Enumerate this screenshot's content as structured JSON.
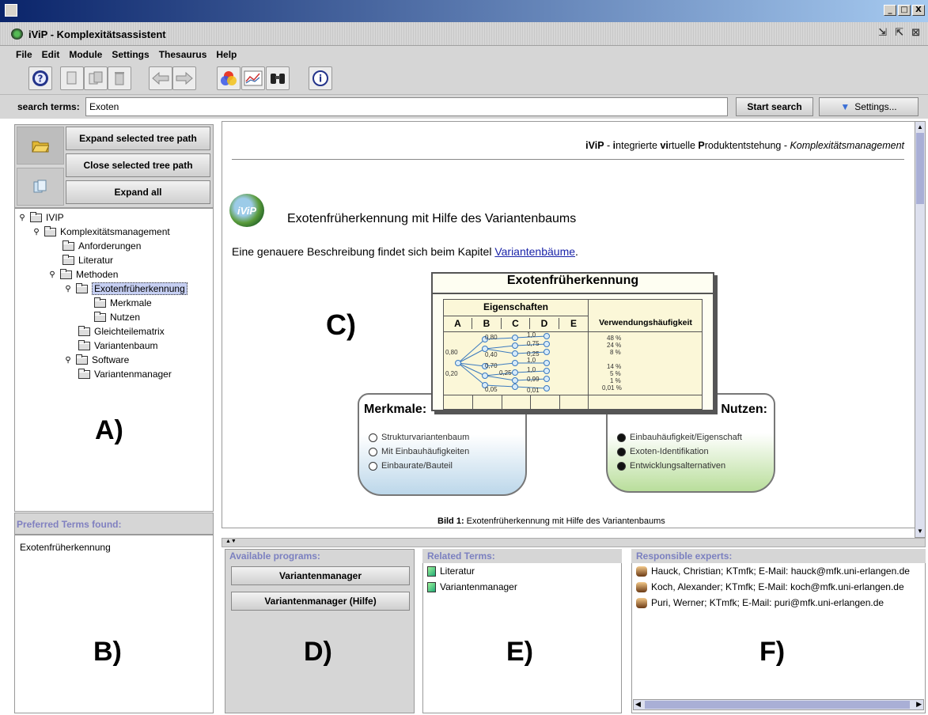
{
  "window": {
    "min_glyph": "_",
    "max_glyph": "□",
    "close_glyph": "X"
  },
  "app": {
    "title": "iViP - Komplexitätsassistent",
    "controls": [
      "⇲",
      "⇱",
      "⊠"
    ]
  },
  "menu": [
    "File",
    "Edit",
    "Module",
    "Settings",
    "Thesaurus",
    "Help"
  ],
  "toolbar": {
    "icons": [
      "help-icon",
      "copy-icon",
      "paste-icon",
      "delete-icon",
      "back-arrow-icon",
      "forward-arrow-icon",
      "colors-icon",
      "chart-icon",
      "binoculars-icon",
      "info-icon"
    ]
  },
  "search": {
    "label": "search terms:",
    "value": "Exoten",
    "start_button": "Start search",
    "settings_button": "Settings..."
  },
  "left": {
    "expand_path": "Expand selected tree path",
    "close_path": "Close selected tree path",
    "expand_all": "Expand all",
    "tree": [
      "IVIP",
      "Komplexitätsmanagement",
      "Anforderungen",
      "Literatur",
      "Methoden",
      "Exotenfrüherkennung",
      "Merkmale",
      "Nutzen",
      "Gleichteilematrix",
      "Variantenbaum",
      "Software",
      "Variantenmanager"
    ],
    "label_a": "A)",
    "preferred_header": "Preferred Terms found:",
    "preferred_items": [
      "Exotenfrüherkennung"
    ],
    "label_b": "B)"
  },
  "content": {
    "header_parts": [
      "iViP",
      " - ",
      "i",
      "ntegrierte ",
      "vi",
      "rtuelle ",
      "P",
      "roduktentstehung - ",
      "Komplexitätsmanagement"
    ],
    "logo_text": "iViP",
    "heading": "Exotenfrüherkennung mit Hilfe des Variantenbaums",
    "desc_before": "Eine genauere Beschreibung findet sich beim Kapitel ",
    "desc_link": "Variantenbäume",
    "desc_after": ".",
    "label_c": "C)",
    "figure": {
      "card_title": "Exotenfrüherkennung",
      "eigenschaften": "Eigenschaften",
      "columns": [
        "A",
        "B",
        "C",
        "D",
        "E"
      ],
      "usage_header": "Verwendungshäufigkeit",
      "usage_values": [
        "48 %",
        "24 %",
        "8 %",
        "14 %",
        "5 %",
        "1 %",
        "0,01 %"
      ],
      "tree_values": [
        "0,80",
        "0,40",
        "0,80",
        "0,20",
        "0,70",
        "0,25",
        "0,05",
        "1,0",
        "0,75",
        "0,25",
        "1,0",
        "1,0",
        "0,99",
        "0,01"
      ],
      "merkmale_title": "Merkmale:",
      "merkmale": [
        "Strukturvariantenbaum",
        "Mit Einbauhäufigkeiten",
        "Einbaurate/Bauteil"
      ],
      "nutzen_title": "Nutzen:",
      "nutzen": [
        "Einbauhäufigkeit/Eigenschaft",
        "Exoten-Identifikation",
        "Entwicklungsalternativen"
      ]
    },
    "caption_bold": "Bild 1:",
    "caption_text": " Exotenfrüherkennung mit Hilfe des Variantenbaums"
  },
  "bottom": {
    "programs_header": "Available programs:",
    "programs": [
      "Variantenmanager",
      "Variantenmanager (Hilfe)"
    ],
    "label_d": "D)",
    "related_header": "Related Terms:",
    "related": [
      "Literatur",
      "Variantenmanager"
    ],
    "label_e": "E)",
    "experts_header": "Responsible experts:",
    "experts": [
      "Hauck, Christian; KTmfk; E-Mail: hauck@mfk.uni-erlangen.de",
      "Koch, Alexander; KTmfk; E-Mail: koch@mfk.uni-erlangen.de",
      "Puri, Werner; KTmfk; E-Mail: puri@mfk.uni-erlangen.de"
    ],
    "label_f": "F)"
  },
  "colors": {
    "title_gradient_start": "#0a246a",
    "panel_header_text": "#7b80c0",
    "link": "#1a23a8",
    "selection": "#c6cff2"
  }
}
